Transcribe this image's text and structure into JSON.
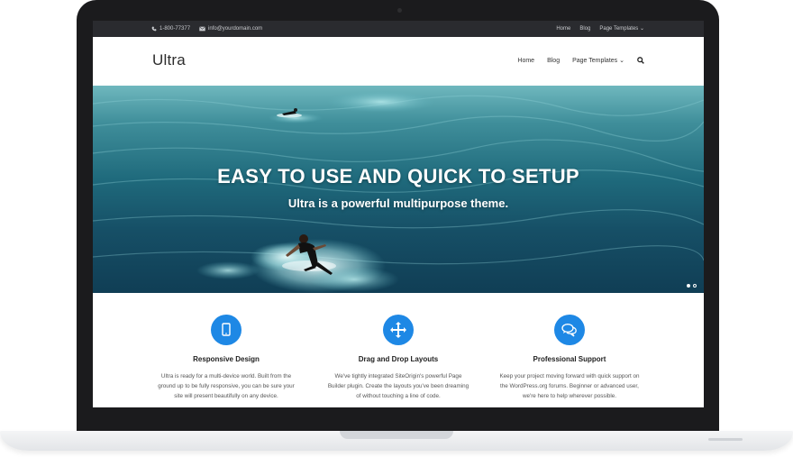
{
  "topbar": {
    "phone": "1-800-77377",
    "email": "info@yourdomain.com",
    "nav": [
      "Home",
      "Blog",
      "Page Templates"
    ]
  },
  "header": {
    "logo": "Ultra",
    "nav": [
      "Home",
      "Blog",
      "Page Templates"
    ]
  },
  "hero": {
    "title": "EASY TO USE AND QUICK TO SETUP",
    "subtitle": "Ultra is a powerful multipurpose theme.",
    "slides": 2,
    "active_slide": 1
  },
  "features": [
    {
      "icon": "mobile-icon",
      "title": "Responsive Design",
      "lines": [
        "Ultra is ready for a multi-device world. Built from the",
        "ground up to be fully responsive, you can be sure your",
        "site will present beautifully on any device."
      ]
    },
    {
      "icon": "move-arrows-icon",
      "title": "Drag and Drop Layouts",
      "lines": [
        "We've tightly integrated SiteOrigin's powerful Page",
        "Builder plugin. Create the layouts you've been dreaming",
        "of without touching a line of code."
      ]
    },
    {
      "icon": "chat-bubbles-icon",
      "title": "Professional Support",
      "lines": [
        "Keep your project moving forward with quick support on",
        "the WordPress.org forums. Beginner or advanced user,",
        "we're here to help wherever possible."
      ]
    }
  ],
  "colors": {
    "accent": "#1e88e5",
    "topbar": "#2a2b2f",
    "bezel": "#1b1b1d"
  }
}
